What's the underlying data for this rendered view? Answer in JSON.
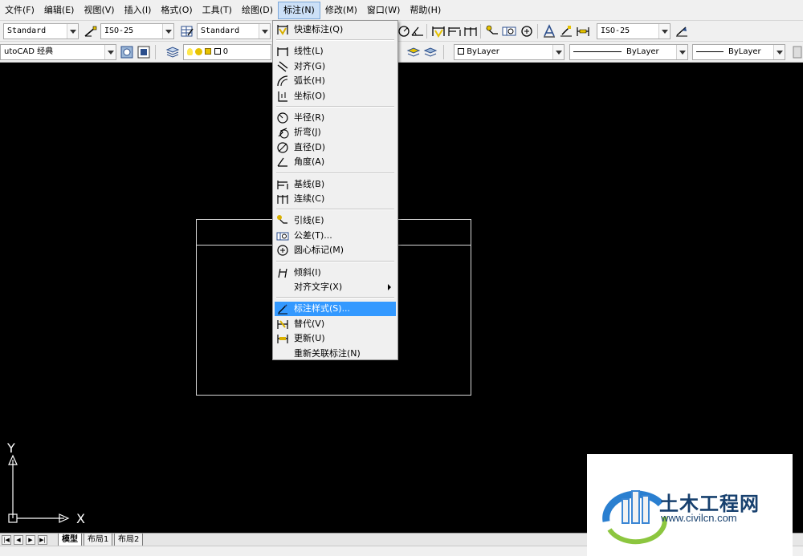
{
  "menubar": {
    "items": [
      "文件(F)",
      "编辑(E)",
      "视图(V)",
      "插入(I)",
      "格式(O)",
      "工具(T)",
      "绘图(D)",
      "标注(N)",
      "修改(M)",
      "窗口(W)",
      "帮助(H)"
    ]
  },
  "toolbar1": {
    "text_style": "Standard",
    "dim_style": "ISO-25",
    "table_style": "Standard",
    "dim_style_right": "ISO-25"
  },
  "toolbar2": {
    "workspace": "utoCAD 经典",
    "layer": "0",
    "color": "ByLayer",
    "linetype": "ByLayer",
    "lineweight": "ByLayer"
  },
  "dimension_menu": {
    "groups": [
      [
        {
          "label": "快速标注(Q)",
          "icon": "quick-dimension-icon"
        }
      ],
      [
        {
          "label": "线性(L)",
          "icon": "linear-icon"
        },
        {
          "label": "对齐(G)",
          "icon": "aligned-icon"
        },
        {
          "label": "弧长(H)",
          "icon": "arc-length-icon"
        },
        {
          "label": "坐标(O)",
          "icon": "ordinate-icon"
        }
      ],
      [
        {
          "label": "半径(R)",
          "icon": "radius-icon"
        },
        {
          "label": "折弯(J)",
          "icon": "jogged-icon"
        },
        {
          "label": "直径(D)",
          "icon": "diameter-icon"
        },
        {
          "label": "角度(A)",
          "icon": "angular-icon"
        }
      ],
      [
        {
          "label": "基线(B)",
          "icon": "baseline-icon"
        },
        {
          "label": "连续(C)",
          "icon": "continue-icon"
        }
      ],
      [
        {
          "label": "引线(E)",
          "icon": "leader-icon"
        },
        {
          "label": "公差(T)...",
          "icon": "tolerance-icon"
        },
        {
          "label": "圆心标记(M)",
          "icon": "center-mark-icon"
        }
      ],
      [
        {
          "label": "倾斜(I)",
          "icon": "oblique-icon"
        },
        {
          "label": "对齐文字(X)",
          "icon": "",
          "submenu": true
        }
      ],
      [
        {
          "label": "标注样式(S)...",
          "icon": "dimension-style-icon",
          "highlighted": true
        },
        {
          "label": "替代(V)",
          "icon": "override-icon"
        },
        {
          "label": "更新(U)",
          "icon": "update-icon"
        },
        {
          "label": "重新关联标注(N)",
          "icon": ""
        }
      ]
    ]
  },
  "ucs": {
    "x_label": "X",
    "y_label": "Y"
  },
  "tabs": [
    "模型",
    "布局1",
    "布局2"
  ],
  "watermark": {
    "title": "土木工程网",
    "url": "www.civilcn.com"
  },
  "colors": {
    "highlight": "#3399ff",
    "canvas": "#000000",
    "menu_bg": "#f0f0f0"
  }
}
